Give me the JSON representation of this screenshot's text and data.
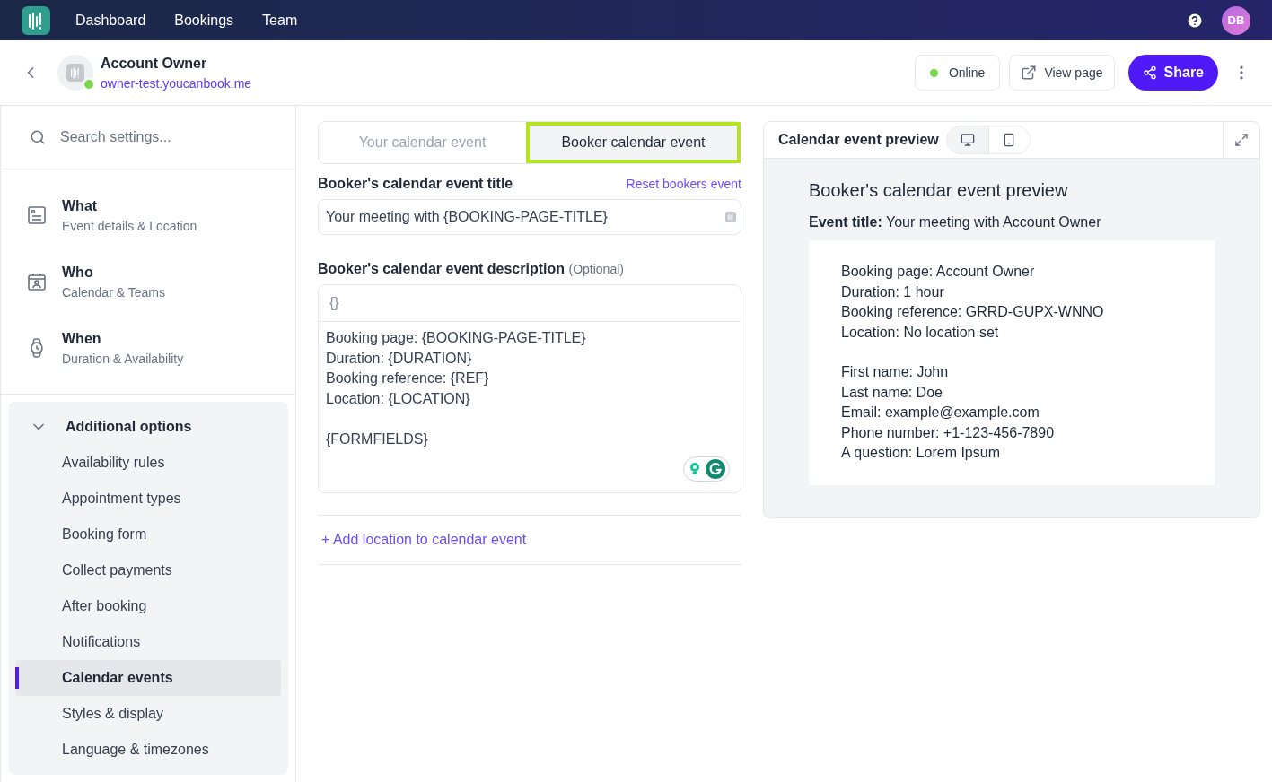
{
  "nav": {
    "items": [
      {
        "label": "Dashboard"
      },
      {
        "label": "Bookings"
      },
      {
        "label": "Team"
      }
    ],
    "avatar": "DB"
  },
  "header": {
    "title": "Account Owner",
    "url": "owner-test.youcanbook.me",
    "status": {
      "label": "Online",
      "online": true
    },
    "view_page": "View page",
    "share": "Share"
  },
  "sidebar": {
    "search_placeholder": "Search settings...",
    "sections": [
      {
        "kind": "what",
        "title": "What",
        "subtitle": "Event details & Location"
      },
      {
        "kind": "who",
        "title": "Who",
        "subtitle": "Calendar & Teams"
      },
      {
        "kind": "when",
        "title": "When",
        "subtitle": "Duration & Availability"
      }
    ],
    "additional": {
      "title": "Additional options",
      "expanded": true,
      "items": [
        {
          "label": "Availability rules",
          "selected": false
        },
        {
          "label": "Appointment types",
          "selected": false
        },
        {
          "label": "Booking form",
          "selected": false
        },
        {
          "label": "Collect payments",
          "selected": false
        },
        {
          "label": "After booking",
          "selected": false
        },
        {
          "label": "Notifications",
          "selected": false
        },
        {
          "label": "Calendar events",
          "selected": true
        },
        {
          "label": "Styles & display",
          "selected": false
        },
        {
          "label": "Language & timezones",
          "selected": false
        }
      ]
    }
  },
  "tabs": [
    {
      "label": "Your calendar event",
      "selected": false
    },
    {
      "label": "Booker calendar event",
      "selected": true
    }
  ],
  "title_field": {
    "label": "Booker's calendar event title",
    "link": "Reset bookers event",
    "value": "Your meeting with {BOOKING-PAGE-TITLE}"
  },
  "description_field": {
    "label": "Booker's calendar event description",
    "optional": "(Optional)",
    "toolbar_symbol": "{}",
    "value": "Booking page: {BOOKING-PAGE-TITLE}\nDuration: {DURATION}\nBooking reference: {REF}\nLocation: {LOCATION}\n\n{FORMFIELDS}"
  },
  "add_location": "+ Add location to calendar event",
  "preview": {
    "title": "Calendar event preview",
    "view_modes": [
      {
        "kind": "desktop",
        "selected": true
      },
      {
        "kind": "mobile",
        "selected": false
      }
    ],
    "heading": "Booker's calendar event preview",
    "event_title_label": "Event title:",
    "event_title_value": "Your meeting with Account Owner",
    "groups": [
      [
        "Booking page: Account Owner",
        "Duration: 1 hour",
        "Booking reference: GRRD-GUPX-WNNO",
        "Location: No location set"
      ],
      [
        "First name: John",
        "Last name: Doe",
        "Email: example@example.com",
        "Phone number: +1-123-456-7890",
        "A question: Lorem Ipsum"
      ]
    ]
  }
}
